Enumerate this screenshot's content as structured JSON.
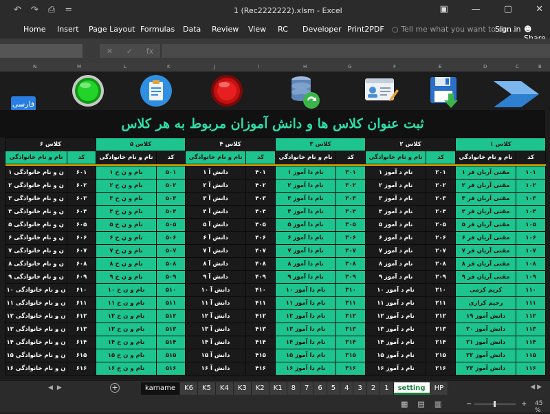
{
  "window": {
    "title": "1 (Rec2222222).xlsm - Excel",
    "qat": [
      "↶",
      "↷",
      "⎙",
      "="
    ],
    "controls": [
      "▣",
      "—",
      "▢",
      "✕"
    ]
  },
  "ribbon": {
    "tabs": [
      "Home",
      "Insert",
      "Page Layout",
      "Formulas",
      "Data",
      "Review",
      "View",
      "RC",
      "Developer",
      "Print2PDF"
    ],
    "tell_me": "Tell me what you want to do...",
    "sign_in": "Sign in",
    "share": "Share"
  },
  "formula_bar": {
    "fx": [
      "✕",
      "✓",
      "fx"
    ]
  },
  "columns": [
    "N",
    "M",
    "L",
    "K",
    "J",
    "I",
    "H",
    "G",
    "F",
    "E",
    "D",
    "C",
    "B"
  ],
  "icons": [
    "keyboard-farsi-icon",
    "green-button-icon",
    "clipboard-icon",
    "red-button-icon",
    "database-sync-icon",
    "id-card-icon",
    "save-download-icon",
    "arrow-next-icon"
  ],
  "farsi_label": "فارسی",
  "sheet_title": "ثبت عنوان کلاس ها و دانش آموزان مربوط به هر کلاس",
  "classes": [
    "کلاس ۶",
    "کلاس ۵",
    "کلاس ۴",
    "کلاس ۳",
    "کلاس ۲",
    "کلاس ۱"
  ],
  "col_headers": {
    "name": "نام و نام خانوادگی",
    "code": "کد"
  },
  "rows": [
    [
      "ن و نام خانوادگی ۱",
      "۶۰۱",
      "نام و ن خ ۱",
      "۵۰۱",
      "دانش آ ۱",
      "۴۰۱",
      "نام دا آموز ۱",
      "۳۰۱",
      "نام د آموز ۱",
      "۲۰۱",
      "مقتی آریان فر ۱",
      "۱۰۱"
    ],
    [
      "ن و نام خانوادگی ۲",
      "۶۰۲",
      "نام و ن خ ۲",
      "۵۰۲",
      "دانش آ ۲",
      "۴۰۲",
      "نام دا آموز ۲",
      "۳۰۲",
      "نام د آموز ۲",
      "۲۰۲",
      "مقتی آریان فر ۲",
      "۱۰۲"
    ],
    [
      "ن و نام خانوادگی ۳",
      "۶۰۳",
      "نام و ن خ ۳",
      "۵۰۳",
      "دانش آ ۳",
      "۴۰۳",
      "نام دا آموز ۳",
      "۳۰۳",
      "نام د آموز ۳",
      "۲۰۳",
      "مقتی آریان فر ۳",
      "۱۰۳"
    ],
    [
      "ن و نام خانوادگی ۴",
      "۶۰۴",
      "نام و ن خ ۴",
      "۵۰۴",
      "دانش آ ۴",
      "۴۰۴",
      "نام دا آموز ۴",
      "۳۰۴",
      "نام د آموز ۴",
      "۲۰۴",
      "مقتی آریان فر ۴",
      "۱۰۴"
    ],
    [
      "ن و نام خانوادگی ۵",
      "۶۰۵",
      "نام و ن خ ۵",
      "۵۰۵",
      "دانش آ ۵",
      "۴۰۵",
      "نام دا آموز ۵",
      "۳۰۵",
      "نام د آموز ۵",
      "۲۰۵",
      "مقتی آریان فر ۵",
      "۱۰۵"
    ],
    [
      "ن و نام خانوادگی ۶",
      "۶۰۶",
      "نام و ن خ ۶",
      "۵۰۶",
      "دانش آ ۶",
      "۴۰۶",
      "نام دا آموز ۶",
      "۳۰۶",
      "نام د آموز ۶",
      "۲۰۶",
      "مقتی آریان فر ۶",
      "۱۰۶"
    ],
    [
      "ن و نام خانوادگی ۷",
      "۶۰۷",
      "نام و ن خ ۷",
      "۵۰۷",
      "دانش آ ۷",
      "۴۰۷",
      "نام دا آموز ۷",
      "۳۰۷",
      "نام د آموز ۷",
      "۲۰۷",
      "مقتی آریان فر ۷",
      "۱۰۷"
    ],
    [
      "ن و نام خانوادگی ۸",
      "۶۰۸",
      "نام و ن خ ۸",
      "۵۰۸",
      "دانش آ ۸",
      "۴۰۸",
      "نام دا آموز ۸",
      "۳۰۸",
      "نام د آموز ۸",
      "۲۰۸",
      "مقتی آریان فر ۸",
      "۱۰۸"
    ],
    [
      "ن و نام خانوادگی ۹",
      "۶۰۹",
      "نام و ن خ ۹",
      "۵۰۹",
      "دانش آ ۹",
      "۴۰۹",
      "نام دا آموز ۹",
      "۳۰۹",
      "نام د آموز ۹",
      "۲۰۹",
      "مقتی آریان فر ۹",
      "۱۰۹"
    ],
    [
      "ن و نام خانوادگی ۱۰",
      "۶۱۰",
      "نام و ن خ ۱۰",
      "۵۱۰",
      "دانش آ ۱۰",
      "۴۱۰",
      "نام دا آموز ۱۰",
      "۳۱۰",
      "نام د آموز ۱۰",
      "۲۱۰",
      "کریم کرمی",
      "۱۱۰"
    ],
    [
      "ن و نام خانوادگی ۱۱",
      "۶۱۱",
      "نام و ن خ ۱۱",
      "۵۱۱",
      "دانش آ ۱۱",
      "۴۱۱",
      "نام دا آموز ۱۱",
      "۳۱۱",
      "نام د آموز ۱۱",
      "۲۱۱",
      "رحیم کراری",
      "۱۱۱"
    ],
    [
      "ن و نام خانوادگی ۱۲",
      "۶۱۲",
      "نام و ن خ ۱۲",
      "۵۱۲",
      "دانش آ ۱۲",
      "۴۱۲",
      "نام دا آموز ۱۲",
      "۳۱۲",
      "نام د آموز ۱۲",
      "۲۱۲",
      "دانش آموز ۱۹",
      "۱۱۲"
    ],
    [
      "ن و نام خانوادگی ۱۳",
      "۶۱۳",
      "نام و ن خ ۱۳",
      "۵۱۳",
      "دانش آ ۱۳",
      "۴۱۳",
      "نام دا آموز ۱۳",
      "۳۱۳",
      "نام د آموز ۱۳",
      "۲۱۳",
      "دانش آموز ۲۰",
      "۱۱۳"
    ],
    [
      "ن و نام خانوادگی ۱۴",
      "۶۱۴",
      "نام و ن خ ۱۴",
      "۵۱۴",
      "دانش آ ۱۴",
      "۴۱۴",
      "نام دا آموز ۱۴",
      "۳۱۴",
      "نام د آموز ۱۴",
      "۲۱۴",
      "دانش آموز ۲۱",
      "۱۱۴"
    ],
    [
      "ن و نام خانوادگی ۱۵",
      "۶۱۵",
      "نام و ن خ ۱۵",
      "۵۱۵",
      "دانش آ ۱۵",
      "۴۱۵",
      "نام دا آموز ۱۵",
      "۳۱۵",
      "نام د آموز ۱۵",
      "۲۱۵",
      "دانش آموز ۲۲",
      "۱۱۵"
    ],
    [
      "ن و نام خانوادگی ۱۶",
      "۶۱۶",
      "نام و ن خ ۱۶",
      "۵۱۶",
      "دانش آ ۱۶",
      "۴۱۶",
      "نام دا آموز ۱۶",
      "۳۱۶",
      "نام د آموز ۱۶",
      "۲۱۶",
      "دانش آموز ۲۳",
      "۱۱۶"
    ]
  ],
  "sheet_tabs": [
    "karname",
    "K6",
    "K5",
    "K4",
    "K3",
    "K2",
    "K1",
    "8",
    "7",
    "6",
    "5",
    "4",
    "3",
    "2",
    "1",
    "setting",
    "HP"
  ],
  "active_tab": "setting",
  "status": {
    "zoom": "45 %",
    "views": [
      "▦",
      "▤",
      "▥"
    ]
  },
  "colors": {
    "green": "#1ec48e",
    "title": "#2ee0a8",
    "separator": "#e8b400",
    "dark": "#1a1a1a"
  }
}
